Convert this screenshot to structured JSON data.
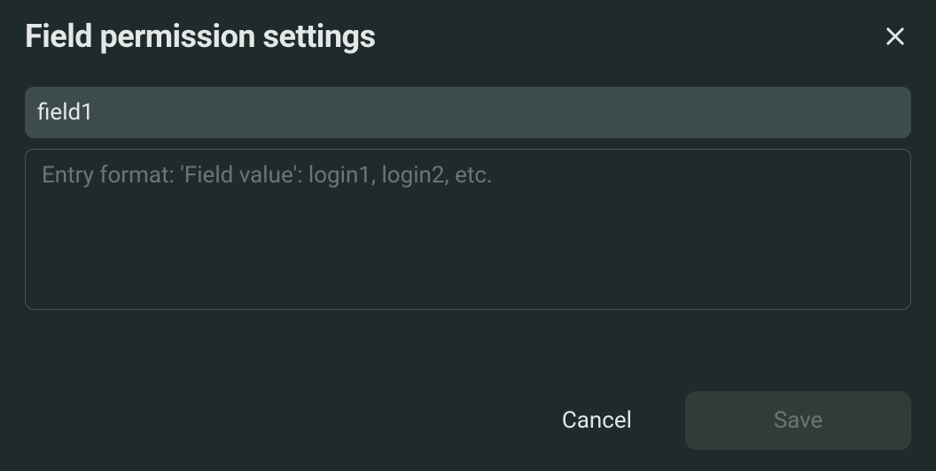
{
  "dialog": {
    "title": "Field permission settings"
  },
  "form": {
    "field_name_value": "field1",
    "permissions_placeholder": "Entry format: 'Field value': login1, login2, etc.",
    "permissions_value": ""
  },
  "footer": {
    "cancel_label": "Cancel",
    "save_label": "Save"
  }
}
